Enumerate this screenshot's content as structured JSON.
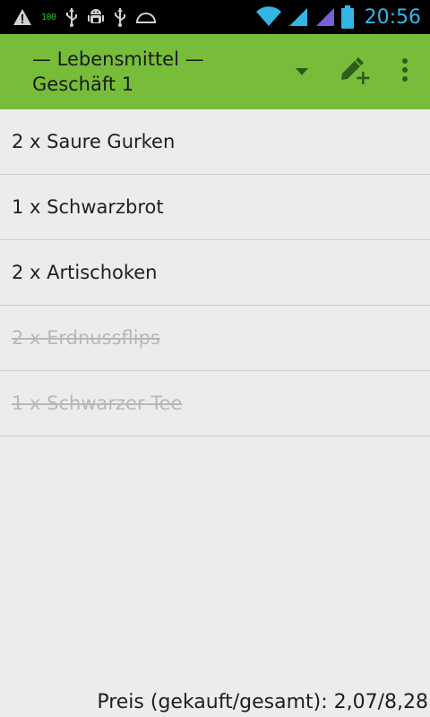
{
  "status_bar": {
    "icons": [
      "warning-icon",
      "battery-100-icon",
      "usb-icon",
      "android-debug-icon",
      "usb-icon",
      "dome-icon",
      "wifi-icon",
      "signal-icon",
      "signal-icon",
      "battery-icon"
    ],
    "battery_label": "100",
    "time": "20:56",
    "colors": {
      "accent": "#33b5e5",
      "battery_green": "#27c227"
    }
  },
  "action_bar": {
    "title_line1": "— Lebensmittel —",
    "title_line2": "Geschäft 1",
    "color": "#77bd3a",
    "icons": [
      "dropdown-arrow-icon",
      "edit-add-icon",
      "overflow-menu-icon"
    ]
  },
  "items": [
    {
      "text": "2 x Saure Gurken",
      "bought": false
    },
    {
      "text": "1 x Schwarzbrot",
      "bought": false
    },
    {
      "text": "2 x Artischoken",
      "bought": false
    },
    {
      "text": "2 x Erdnussflips",
      "bought": true
    },
    {
      "text": "1 x Schwarzer Tee",
      "bought": true
    }
  ],
  "footer": {
    "price_text": "Preis (gekauft/gesamt): 2,07/8,28"
  }
}
